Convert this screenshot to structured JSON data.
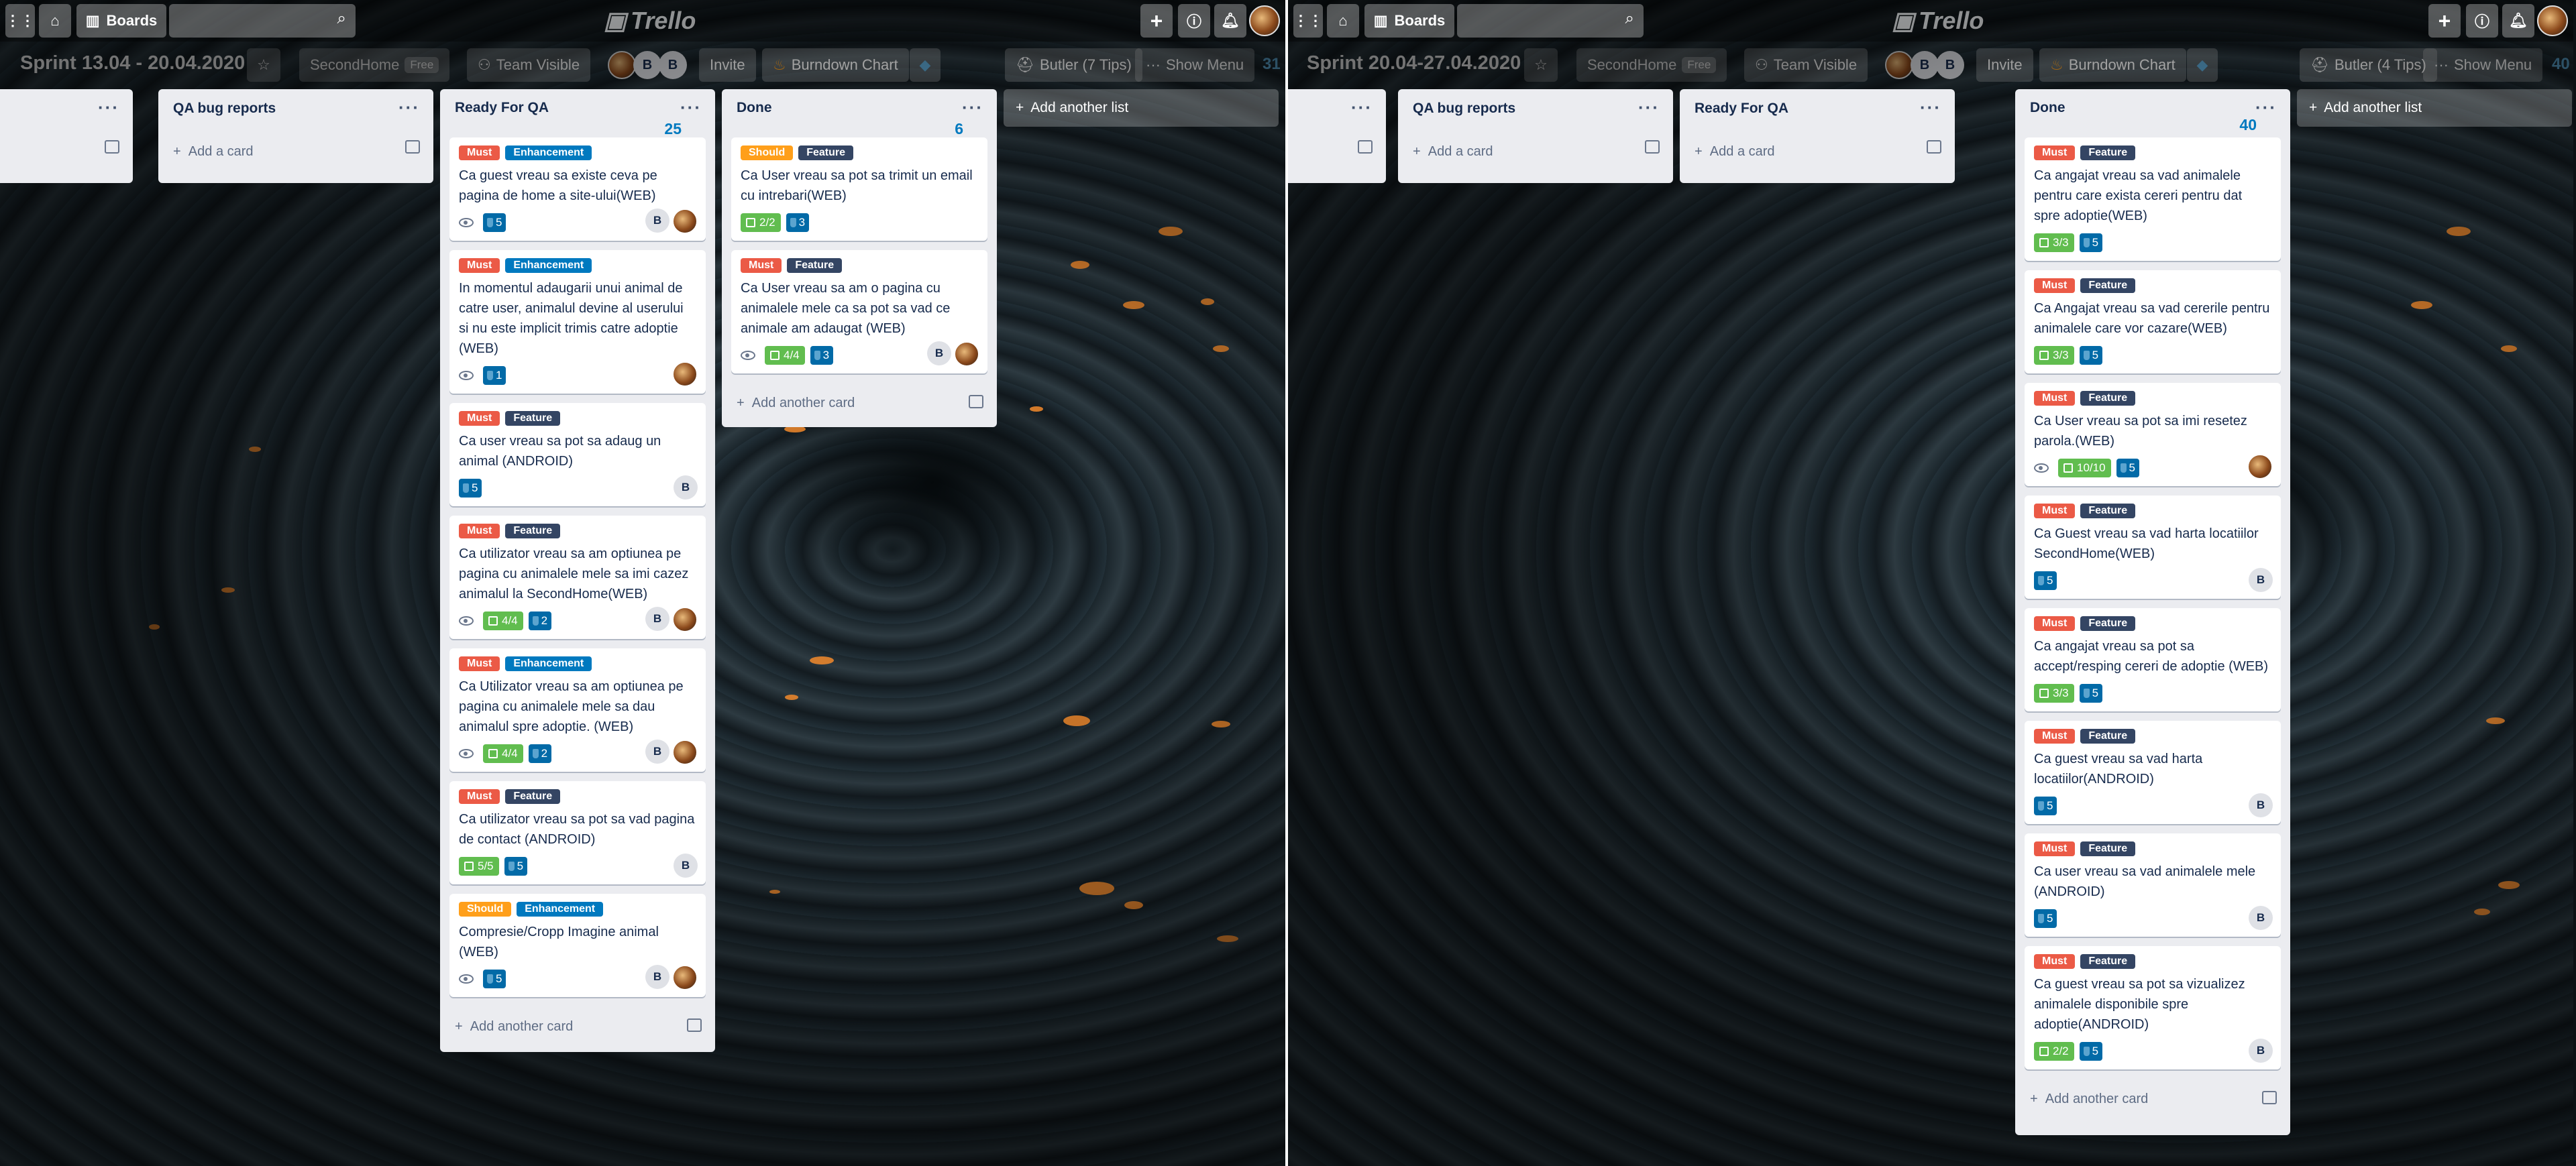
{
  "header": {
    "boards_label": "Boards",
    "logo": "Trello"
  },
  "boards": [
    {
      "title": "Sprint 13.04 - 20.04.2020",
      "team": "SecondHome",
      "plan": "Free",
      "visibility": "Team Visible",
      "members": [
        "B",
        "B"
      ],
      "invite": "Invite",
      "burndown": "Burndown Chart",
      "butler": "Butler (7 Tips)",
      "menu": "Show Menu",
      "count": "31",
      "add_list": "Add another list",
      "lists": [
        {
          "title": "",
          "count": "",
          "add": ""
        },
        {
          "title": "QA bug reports",
          "count": "",
          "add": "Add a card"
        },
        {
          "title": "Ready For QA",
          "count": "25",
          "add": "Add another card"
        },
        {
          "title": "Done",
          "count": "6",
          "add": "Add another card"
        }
      ],
      "cards": {
        "ready": [
          {
            "labels": [
              "Must",
              "Enhancement"
            ],
            "text": "Ca guest vreau sa existe ceva pe pagina de home a site-ului(WEB)",
            "eye": true,
            "checklist": "",
            "points": "5",
            "members": [
              "B",
              "photo"
            ]
          },
          {
            "labels": [
              "Must",
              "Enhancement"
            ],
            "text": "In momentul adaugarii unui animal de catre user, animalul devine al userului si nu este implicit trimis catre adoptie (WEB)",
            "eye": true,
            "checklist": "",
            "points": "1",
            "members": [
              "photo"
            ]
          },
          {
            "labels": [
              "Must",
              "Feature"
            ],
            "text": "Ca user vreau sa pot sa adaug un animal (ANDROID)",
            "eye": false,
            "checklist": "",
            "points": "5",
            "members": [
              "B"
            ]
          },
          {
            "labels": [
              "Must",
              "Feature"
            ],
            "text": "Ca utilizator vreau sa am optiunea pe pagina cu animalele mele sa imi cazez animalul la SecondHome(WEB)",
            "eye": true,
            "checklist": "4/4",
            "points": "2",
            "members": [
              "B",
              "photo"
            ]
          },
          {
            "labels": [
              "Must",
              "Enhancement"
            ],
            "text": "Ca Utilizator vreau sa am optiunea pe pagina cu animalele mele sa dau animalul spre adoptie. (WEB)",
            "eye": true,
            "checklist": "4/4",
            "points": "2",
            "members": [
              "B",
              "photo"
            ]
          },
          {
            "labels": [
              "Must",
              "Feature"
            ],
            "text": "Ca utilizator vreau sa pot sa vad pagina de contact (ANDROID)",
            "eye": false,
            "checklist": "5/5",
            "points": "5",
            "members": [
              "B"
            ]
          },
          {
            "labels": [
              "Should",
              "Enhancement"
            ],
            "text": "Compresie/Cropp Imagine animal (WEB)",
            "eye": true,
            "checklist": "",
            "points": "5",
            "members": [
              "B",
              "photo"
            ]
          }
        ],
        "done": [
          {
            "labels": [
              "Should",
              "Feature"
            ],
            "text": "Ca User vreau sa pot sa trimit un email cu intrebari(WEB)",
            "eye": false,
            "checklist": "2/2",
            "points": "3",
            "members": []
          },
          {
            "labels": [
              "Must",
              "Feature"
            ],
            "text": "Ca User vreau sa am o pagina cu animalele mele ca sa pot sa vad ce animale am adaugat (WEB)",
            "eye": true,
            "checklist": "4/4",
            "points": "3",
            "members": [
              "B",
              "photo"
            ]
          }
        ]
      }
    },
    {
      "title": "Sprint 20.04-27.04.2020",
      "team": "SecondHome",
      "plan": "Free",
      "visibility": "Team Visible",
      "members": [
        "B",
        "B"
      ],
      "invite": "Invite",
      "burndown": "Burndown Chart",
      "butler": "Butler (4 Tips)",
      "menu": "Show Menu",
      "count": "40",
      "add_list": "Add another list",
      "lists": [
        {
          "title": "",
          "count": "",
          "add": ""
        },
        {
          "title": "QA bug reports",
          "count": "",
          "add": "Add a card"
        },
        {
          "title": "Ready For QA",
          "count": "",
          "add": "Add a card"
        },
        {
          "title": "Done",
          "count": "40",
          "add": "Add another card"
        }
      ],
      "cards": {
        "done": [
          {
            "labels": [
              "Must",
              "Feature"
            ],
            "text": "Ca angajat vreau sa vad animalele pentru care exista cereri pentru dat spre adoptie(WEB)",
            "eye": false,
            "checklist": "3/3",
            "points": "5",
            "members": []
          },
          {
            "labels": [
              "Must",
              "Feature"
            ],
            "text": "Ca Angajat vreau sa vad cererile pentru animalele care vor cazare(WEB)",
            "eye": false,
            "checklist": "3/3",
            "points": "5",
            "members": []
          },
          {
            "labels": [
              "Must",
              "Feature"
            ],
            "text": "Ca User vreau sa pot sa imi resetez parola.(WEB)",
            "eye": true,
            "checklist": "10/10",
            "points": "5",
            "members": [
              "photo"
            ]
          },
          {
            "labels": [
              "Must",
              "Feature"
            ],
            "text": "Ca Guest vreau sa vad harta locatiilor SecondHome(WEB)",
            "eye": false,
            "checklist": "",
            "points": "5",
            "members": [
              "B"
            ]
          },
          {
            "labels": [
              "Must",
              "Feature"
            ],
            "text": "Ca angajat vreau sa pot sa accept/resping cereri de adoptie (WEB)",
            "eye": false,
            "checklist": "3/3",
            "points": "5",
            "members": []
          },
          {
            "labels": [
              "Must",
              "Feature"
            ],
            "text": "Ca guest vreau sa vad harta locatiilor(ANDROID)",
            "eye": false,
            "checklist": "",
            "points": "5",
            "members": [
              "B"
            ]
          },
          {
            "labels": [
              "Must",
              "Feature"
            ],
            "text": "Ca user vreau sa vad animalele mele (ANDROID)",
            "eye": false,
            "checklist": "",
            "points": "5",
            "members": [
              "B"
            ]
          },
          {
            "labels": [
              "Must",
              "Feature"
            ],
            "text": "Ca guest vreau sa pot sa vizualizez animalele disponibile spre adoptie(ANDROID)",
            "eye": false,
            "checklist": "2/2",
            "points": "5",
            "members": [
              "B"
            ]
          }
        ]
      }
    }
  ],
  "colors": {
    "must": "#eb5a46",
    "should": "#ff9f1a",
    "enhancement": "#0079bf",
    "feature": "#344563",
    "checklist_done": "#61bd4f",
    "points": "#026aa7"
  }
}
